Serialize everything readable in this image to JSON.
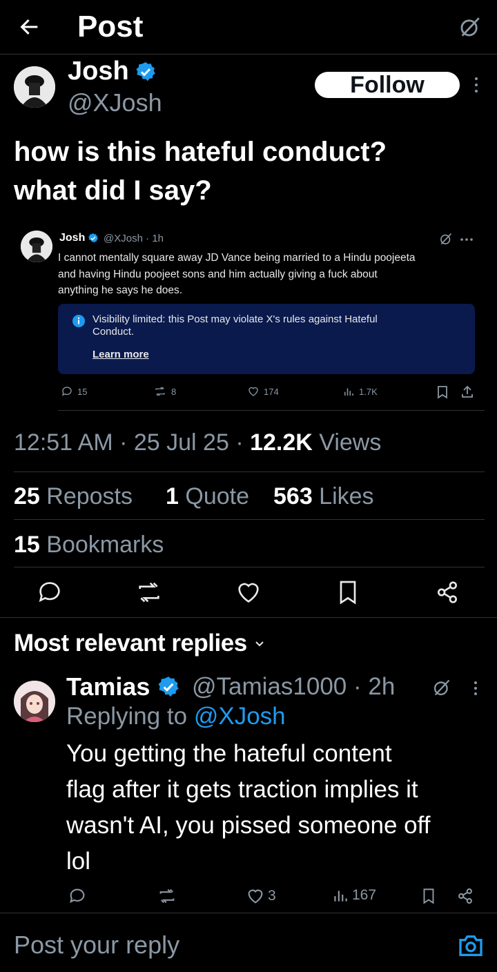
{
  "header": {
    "title": "Post",
    "back_icon": "arrow-left-icon",
    "grok_icon": "grok-icon"
  },
  "author": {
    "name": "Josh",
    "verified": true,
    "handle": "@XJosh",
    "follow_label": "Follow"
  },
  "post": {
    "lines": [
      "how is this hateful conduct?",
      "what did I say?"
    ]
  },
  "embedded": {
    "name": "Josh",
    "meta": "@XJosh · 1h",
    "text_lines": [
      "I cannot mentally square away JD Vance being married to a Hindu poojeeta",
      "and having Hindu poojeet sons and him actually giving a fuck about",
      "anything he says he does."
    ],
    "notice_lines": [
      "Visibility limited: this Post may violate X's rules against Hateful",
      "Conduct."
    ],
    "learn_more": "Learn more",
    "replies": "15",
    "reposts": "8",
    "likes": "174",
    "views": "1.7K"
  },
  "meta": {
    "time": "12:51 AM",
    "sep1": " · ",
    "date": "25 Jul 25",
    "sep2": " · ",
    "views_count": "12.2K",
    "views_label": " Views"
  },
  "stats": {
    "reposts_count": "25",
    "reposts_label": " Reposts",
    "quotes_count": "1",
    "quotes_label": " Quote",
    "likes_count": "563",
    "likes_label": " Likes",
    "bookmarks_count": "15",
    "bookmarks_label": " Bookmarks"
  },
  "replies_header": {
    "label": "Most relevant replies",
    "icon": "chevron-down-icon"
  },
  "reply": {
    "name": "Tamias",
    "verified": true,
    "handle": "@Tamias1000 · 2h",
    "replying_prefix": "Replying to ",
    "replying_handle": "@XJosh",
    "text_lines": [
      "You getting the hateful content",
      "flag after it gets traction implies it",
      "wasn't AI, you pissed someone off",
      "lol"
    ],
    "likes": "3",
    "views": "167"
  },
  "composer": {
    "placeholder": "Post your reply",
    "camera_icon": "camera-icon"
  },
  "colors": {
    "background": "#000000",
    "accent": "#1d9bf0",
    "muted": "#8b98a5",
    "notice_bg": "#0a1a4d"
  }
}
